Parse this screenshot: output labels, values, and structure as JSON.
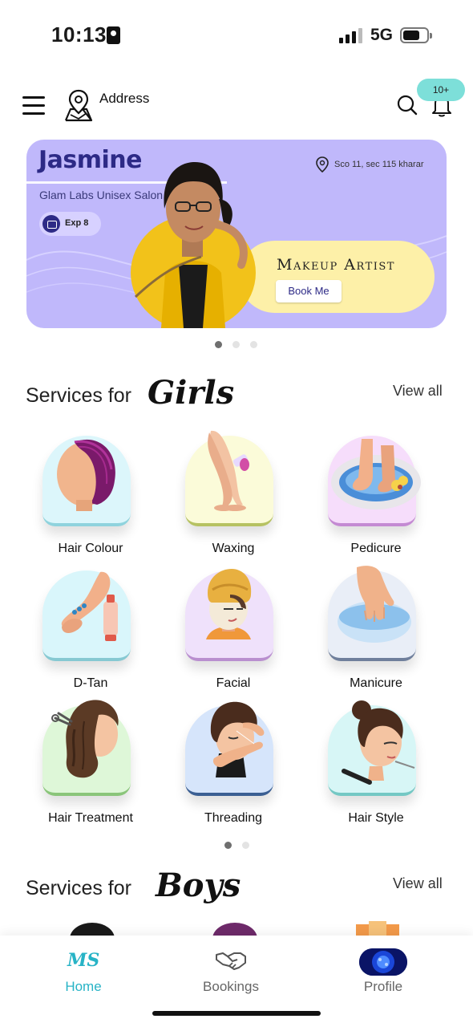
{
  "status_bar": {
    "time": "10:13",
    "network": "5G"
  },
  "header": {
    "address_label": "Address",
    "notification_badge": "10+"
  },
  "banner": {
    "name": "Jasmine",
    "salon": "Glam Labs Unisex Salon",
    "experience": "Exp 8",
    "location": "Sco 11, sec 115 kharar",
    "role": "Makeup Artist",
    "cta": "Book Me",
    "active_slide": 1,
    "slide_count": 3
  },
  "girls_section": {
    "heading": "Services for",
    "script": "Girls",
    "view_all": "View all",
    "services": [
      {
        "label": "Hair Colour",
        "icon": "hair-colour-icon",
        "bg": "#dcf6fb",
        "border": "#8fd3dd"
      },
      {
        "label": "Waxing",
        "icon": "waxing-icon",
        "bg": "#fbfbd9",
        "border": "#b6c262"
      },
      {
        "label": "Pedicure",
        "icon": "pedicure-icon",
        "bg": "#f6ddfb",
        "border": "#c48ad3"
      },
      {
        "label": "D-Tan",
        "icon": "dtan-icon",
        "bg": "#d9f6fb",
        "border": "#86c9d2"
      },
      {
        "label": "Facial",
        "icon": "facial-icon",
        "bg": "#efe1fb",
        "border": "#b98fcf"
      },
      {
        "label": "Manicure",
        "icon": "manicure-icon",
        "bg": "#e9eef7",
        "border": "#6f7f9c"
      },
      {
        "label": "Hair Treatment",
        "icon": "hair-treatment-icon",
        "bg": "#def7d8",
        "border": "#8ac57a"
      },
      {
        "label": "Threading",
        "icon": "threading-icon",
        "bg": "#d6e5fb",
        "border": "#3b5f93"
      },
      {
        "label": "Hair Style",
        "icon": "hair-style-icon",
        "bg": "#d7f6f6",
        "border": "#74c8c4"
      }
    ],
    "active_page": 1,
    "page_count": 2
  },
  "boys_section": {
    "heading": "Services for",
    "script": "Boys",
    "view_all": "View all"
  },
  "bottom_nav": [
    {
      "label": "Home",
      "icon": "ms-logo-icon",
      "active": true
    },
    {
      "label": "Bookings",
      "icon": "handshake-icon",
      "active": false
    },
    {
      "label": "Profile",
      "icon": "profile-avatar",
      "active": false
    }
  ],
  "colors": {
    "accent": "#27b3c6",
    "banner_bg": "#c0b8fb",
    "banner_title": "#2d2a86",
    "banner_highlight": "#fdf0a8",
    "badge": "#7ddfd9"
  }
}
